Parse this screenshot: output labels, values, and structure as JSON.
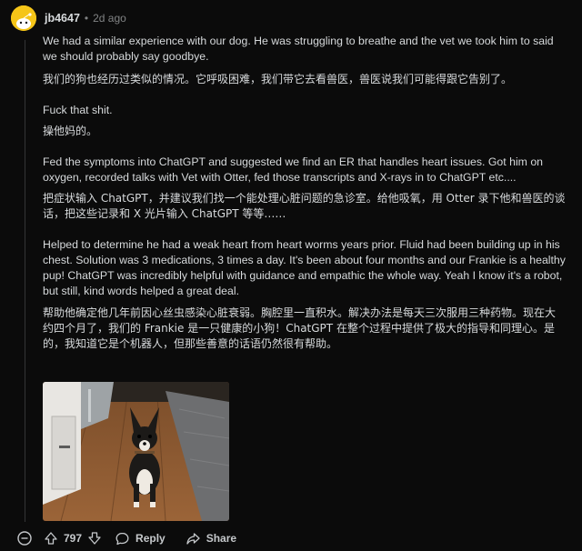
{
  "comment": {
    "username": "jb4647",
    "separator": "•",
    "timestamp": "2d ago",
    "paragraphs": [
      {
        "en": "We had a similar experience with our dog. He was struggling to breathe and the vet we took him to said we should probably say goodbye.",
        "zh": "我们的狗也经历过类似的情况。它呼吸困难，我们带它去看兽医，兽医说我们可能得跟它告别了。"
      },
      {
        "en": "Fuck that shit.",
        "zh": "操他妈的。"
      },
      {
        "en": "Fed the symptoms into ChatGPT and suggested we find an ER that handles heart issues. Got him on oxygen, recorded talks with Vet with Otter, fed those transcripts and X-rays in to ChatGPT etc....",
        "zh": "把症状输入 ChatGPT，并建议我们找一个能处理心脏问题的急诊室。给他吸氧，用 Otter 录下他和兽医的谈话，把这些记录和 X 光片输入 ChatGPT 等等……"
      },
      {
        "en": "Helped to determine he had a weak heart from heart worms years prior. Fluid had been building up in his chest. Solution was 3 medications, 3 times a day. It's been about four months and our Frankie is a healthy pup! ChatGPT was incredibly helpful with guidance and empathic the whole way. Yeah I know it's a robot, but still, kind words helped a great deal.",
        "zh": "帮助他确定他几年前因心丝虫感染心脏衰弱。胸腔里一直积水。解决办法是每天三次服用三种药物。现在大约四个月了，我们的 Frankie 是一只健康的小狗！ChatGPT 在整个过程中提供了极大的指导和同理心。是的，我知道它是个机器人，但那些善意的话语仍然很有帮助。"
      }
    ],
    "actions": {
      "vote_count": "797",
      "reply_label": "Reply",
      "share_label": "Share"
    }
  },
  "colors": {
    "background": "#0b0b0b",
    "text": "#d7dadc",
    "muted": "#818384",
    "avatar": "#f5c518"
  }
}
